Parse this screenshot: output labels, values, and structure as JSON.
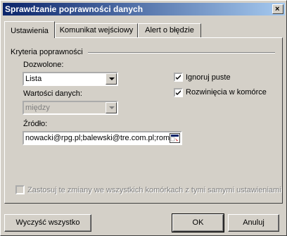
{
  "window": {
    "title": "Sprawdzanie poprawności danych",
    "close_label": "×"
  },
  "tabs": [
    {
      "label": "Ustawienia"
    },
    {
      "label": "Komunikat wejściowy"
    },
    {
      "label": "Alert o błędzie"
    }
  ],
  "criteria": {
    "group_label": "Kryteria poprawności",
    "allow_label": "Dozwolone:",
    "allow_value": "Lista",
    "data_label": "Wartości danych:",
    "data_value": "między",
    "ignore_blank": {
      "label": "Ignoruj puste",
      "checked": true
    },
    "in_cell_dropdown": {
      "label": "Rozwinięcia w komórce",
      "checked": true
    },
    "source_label": "Źródło:",
    "source_value": "nowacki@rpg.pl;balewski@tre.com.pl;rom"
  },
  "apply_all": {
    "label": "Zastosuj te zmiany we wszystkich komórkach z tymi samymi ustawieniami",
    "checked": false
  },
  "buttons": {
    "clear_all": "Wyczyść wszystko",
    "ok": "OK",
    "cancel": "Anuluj"
  }
}
